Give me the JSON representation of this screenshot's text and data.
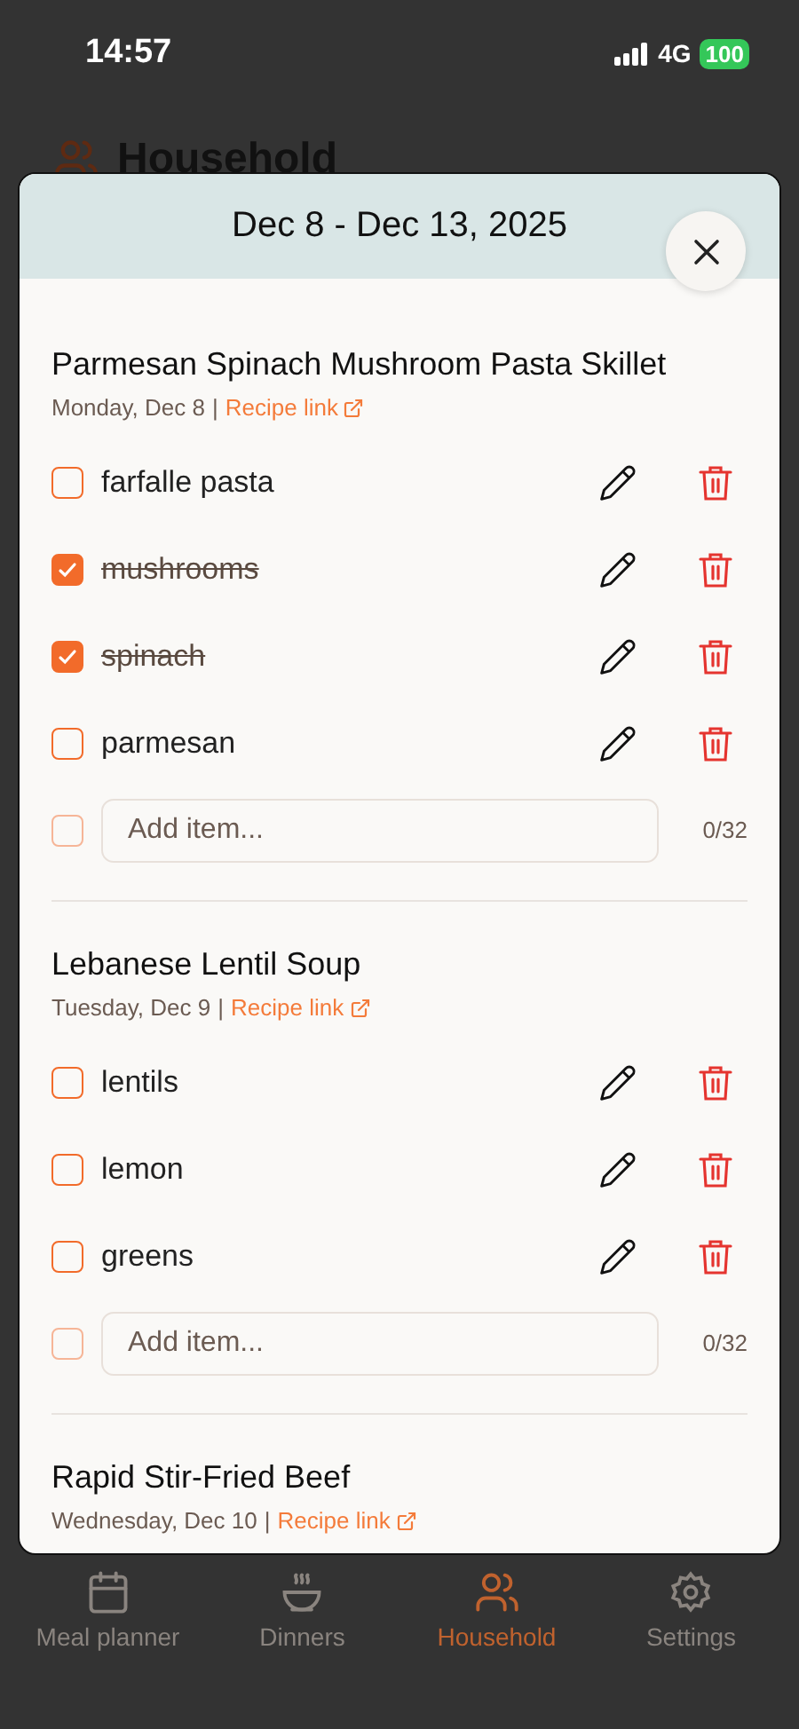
{
  "status_bar": {
    "time": "14:57",
    "network": "4G",
    "battery": "100"
  },
  "page": {
    "title": "Household"
  },
  "modal": {
    "title": "Dec 8 - Dec 13, 2025",
    "meals": [
      {
        "name": "Parmesan Spinach Mushroom Pasta Skillet",
        "day": "Monday, Dec 8",
        "separator": "|",
        "link": "Recipe link",
        "items": [
          {
            "name": "farfalle pasta",
            "checked": false
          },
          {
            "name": "mushrooms",
            "checked": true
          },
          {
            "name": "spinach",
            "checked": true
          },
          {
            "name": "parmesan",
            "checked": false
          }
        ],
        "add_placeholder": "Add item...",
        "add_checked": false,
        "counter": "0/32"
      },
      {
        "name": "Lebanese Lentil Soup",
        "day": "Tuesday, Dec 9",
        "separator": "|",
        "link": "Recipe link",
        "items": [
          {
            "name": "lentils",
            "checked": false
          },
          {
            "name": "lemon",
            "checked": false
          },
          {
            "name": "greens",
            "checked": false
          }
        ],
        "add_placeholder": "Add item...",
        "add_checked": false,
        "counter": "0/32"
      },
      {
        "name": "Rapid Stir-Fried Beef",
        "day": "Wednesday, Dec 10",
        "separator": "|",
        "link": "Recipe link"
      }
    ]
  },
  "tab_bar": [
    {
      "label": "Meal planner",
      "selected": false
    },
    {
      "label": "Dinners",
      "selected": false
    },
    {
      "label": "Household",
      "selected": true
    },
    {
      "label": "Settings",
      "selected": false
    }
  ]
}
